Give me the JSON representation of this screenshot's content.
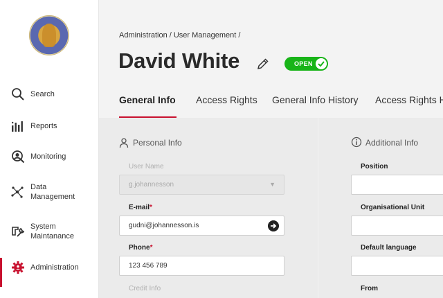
{
  "sidebar": {
    "items": [
      {
        "label": "Search",
        "icon": "search-icon"
      },
      {
        "label": "Reports",
        "icon": "bar-chart-icon"
      },
      {
        "label": "Monitoring",
        "icon": "monitoring-icon"
      },
      {
        "label": "Data Management",
        "line1": "Data",
        "line2": "Management",
        "icon": "network-icon"
      },
      {
        "label": "System Maintanance",
        "line1": "System",
        "line2": "Maintanance",
        "icon": "wrench-icon"
      },
      {
        "label": "Administration",
        "icon": "admin-gear-icon"
      }
    ],
    "active_index": 5,
    "accent_color": "#c8102e"
  },
  "header": {
    "breadcrumb": "Administration / User Management /",
    "title": "David White",
    "status_badge": "OPEN",
    "status_color": "#18b418"
  },
  "tabs": [
    {
      "label": "General Info",
      "active": true
    },
    {
      "label": "Access Rights",
      "active": false
    },
    {
      "label": "General Info History",
      "active": false
    },
    {
      "label": "Access Rights His",
      "active": false
    }
  ],
  "personal_info": {
    "title": "Personal Info",
    "user_name": {
      "label": "User Name",
      "value": "g.johannesson"
    },
    "email": {
      "label": "E-mail",
      "required_mark": "*",
      "value": "gudni@johannesson.is"
    },
    "phone": {
      "label": "Phone",
      "required_mark": "*",
      "value": "123 456 789"
    },
    "credit_info": {
      "label": "Credit Info"
    }
  },
  "additional_info": {
    "title": "Additional Info",
    "position": {
      "label": "Position",
      "value": ""
    },
    "organisational_unit": {
      "label": "Organisational Unit",
      "value": ""
    },
    "default_language": {
      "label": "Default language",
      "value": ""
    },
    "from": {
      "label": "From",
      "value": ""
    }
  }
}
